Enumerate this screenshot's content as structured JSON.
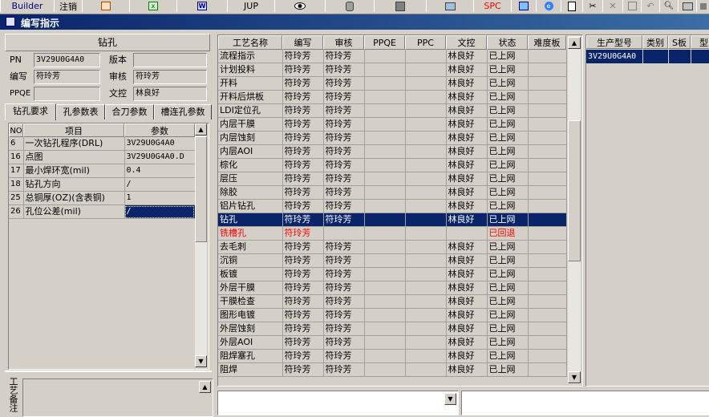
{
  "toolbar": {
    "builder": "Builder",
    "logout": "注销",
    "jup": "JUP",
    "spc": "SPC"
  },
  "window": {
    "title": "编写指示"
  },
  "left": {
    "section_title": "钻孔",
    "pn_label": "PN",
    "pn_value": "3V29U0G4A0",
    "version_label": "版本",
    "version_value": "",
    "author_label": "编写",
    "author_value": "符玲芳",
    "reviewer_label": "审核",
    "reviewer_value": "符玲芳",
    "ppqe_label": "PPQE",
    "ppqe_value": "",
    "doc_label": "文控",
    "doc_value": "林良好",
    "tabs": [
      "钻孔要求",
      "孔参数表",
      "合刀参数",
      "槽连孔参数"
    ],
    "table_headers": [
      "NO",
      "项目",
      "参数"
    ],
    "rows": [
      {
        "no": "6",
        "item": "一次钻孔程序(DRL)",
        "param": "3V29U0G4A0"
      },
      {
        "no": "16",
        "item": "点图",
        "param": "3V29U0G4A0.D"
      },
      {
        "no": "17",
        "item": "最小焊环宽(mil)",
        "param": "0.4"
      },
      {
        "no": "18",
        "item": "钻孔方向",
        "param": "/"
      },
      {
        "no": "25",
        "item": "总铜厚(OZ)(含表铜)",
        "param": "1"
      },
      {
        "no": "26",
        "item": "孔位公差(mil)",
        "param": "/"
      }
    ],
    "notes_label": "工艺备注"
  },
  "middle": {
    "headers": [
      "工艺名称",
      "编写",
      "审核",
      "PPQE",
      "PPC",
      "文控",
      "状态",
      "难度板"
    ],
    "rows": [
      {
        "name": "流程指示",
        "author": "符玲芳",
        "reviewer": "符玲芳",
        "doc": "林良好",
        "status": "已上网"
      },
      {
        "name": "计划投料",
        "author": "符玲芳",
        "reviewer": "符玲芳",
        "doc": "林良好",
        "status": "已上网"
      },
      {
        "name": "开料",
        "author": "符玲芳",
        "reviewer": "符玲芳",
        "doc": "林良好",
        "status": "已上网"
      },
      {
        "name": "开料后烘板",
        "author": "符玲芳",
        "reviewer": "符玲芳",
        "doc": "林良好",
        "status": "已上网"
      },
      {
        "name": "LDI定位孔",
        "author": "符玲芳",
        "reviewer": "符玲芳",
        "doc": "林良好",
        "status": "已上网"
      },
      {
        "name": "内层干膜",
        "author": "符玲芳",
        "reviewer": "符玲芳",
        "doc": "林良好",
        "status": "已上网"
      },
      {
        "name": "内层蚀刻",
        "author": "符玲芳",
        "reviewer": "符玲芳",
        "doc": "林良好",
        "status": "已上网"
      },
      {
        "name": "内层AOI",
        "author": "符玲芳",
        "reviewer": "符玲芳",
        "doc": "林良好",
        "status": "已上网"
      },
      {
        "name": "棕化",
        "author": "符玲芳",
        "reviewer": "符玲芳",
        "doc": "林良好",
        "status": "已上网"
      },
      {
        "name": "层压",
        "author": "符玲芳",
        "reviewer": "符玲芳",
        "doc": "林良好",
        "status": "已上网"
      },
      {
        "name": "除胶",
        "author": "符玲芳",
        "reviewer": "符玲芳",
        "doc": "林良好",
        "status": "已上网"
      },
      {
        "name": "铝片钻孔",
        "author": "符玲芳",
        "reviewer": "符玲芳",
        "doc": "林良好",
        "status": "已上网"
      },
      {
        "name": "钻孔",
        "author": "符玲芳",
        "reviewer": "符玲芳",
        "doc": "林良好",
        "status": "已上网",
        "selected": true
      },
      {
        "name": "铣槽孔",
        "author": "符玲芳",
        "reviewer": "",
        "doc": "",
        "status": "已回退",
        "red": true
      },
      {
        "name": "去毛刺",
        "author": "符玲芳",
        "reviewer": "符玲芳",
        "doc": "林良好",
        "status": "已上网"
      },
      {
        "name": "沉铜",
        "author": "符玲芳",
        "reviewer": "符玲芳",
        "doc": "林良好",
        "status": "已上网"
      },
      {
        "name": "板镀",
        "author": "符玲芳",
        "reviewer": "符玲芳",
        "doc": "林良好",
        "status": "已上网"
      },
      {
        "name": "外层干膜",
        "author": "符玲芳",
        "reviewer": "符玲芳",
        "doc": "林良好",
        "status": "已上网"
      },
      {
        "name": "干膜检查",
        "author": "符玲芳",
        "reviewer": "符玲芳",
        "doc": "林良好",
        "status": "已上网"
      },
      {
        "name": "图形电镀",
        "author": "符玲芳",
        "reviewer": "符玲芳",
        "doc": "林良好",
        "status": "已上网"
      },
      {
        "name": "外层蚀刻",
        "author": "符玲芳",
        "reviewer": "符玲芳",
        "doc": "林良好",
        "status": "已上网"
      },
      {
        "name": "外层AOI",
        "author": "符玲芳",
        "reviewer": "符玲芳",
        "doc": "林良好",
        "status": "已上网"
      },
      {
        "name": "阻焊塞孔",
        "author": "符玲芳",
        "reviewer": "符玲芳",
        "doc": "林良好",
        "status": "已上网"
      },
      {
        "name": "阻焊",
        "author": "符玲芳",
        "reviewer": "符玲芳",
        "doc": "林良好",
        "status": "已上网"
      }
    ]
  },
  "right": {
    "headers": [
      "生产型号",
      "类别",
      "S板",
      "型"
    ],
    "rows": [
      {
        "model": "3V29U0G4A0"
      }
    ]
  }
}
